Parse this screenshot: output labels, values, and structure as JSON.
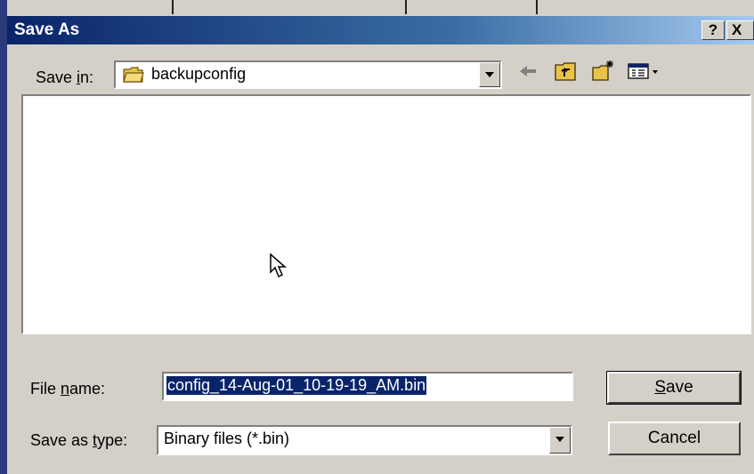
{
  "dialog": {
    "title": "Save As",
    "help_label": "?",
    "close_label": "X"
  },
  "save_in": {
    "label_prefix": "Save ",
    "label_accel": "i",
    "label_suffix": "n:",
    "folder": "backupconfig",
    "folder_icon": "folder-icon"
  },
  "toolbar": {
    "back_icon": "back-arrow-icon",
    "up_icon": "up-folder-icon",
    "new_folder_icon": "new-folder-icon",
    "views_icon": "views-menu-icon"
  },
  "file_name": {
    "label_prefix": "File ",
    "label_accel": "n",
    "label_suffix": "ame:",
    "value": "config_14-Aug-01_10-19-19_AM.bin"
  },
  "save_as_type": {
    "label_prefix": "Save as ",
    "label_accel": "t",
    "label_suffix": "ype:",
    "value": "Binary files (*.bin)"
  },
  "buttons": {
    "save_accel": "S",
    "save_rest": "ave",
    "cancel": "Cancel"
  },
  "colors": {
    "title_start": "#0a246a",
    "title_end": "#a6caf0",
    "face": "#d4d0c8",
    "selection": "#0a246a"
  }
}
